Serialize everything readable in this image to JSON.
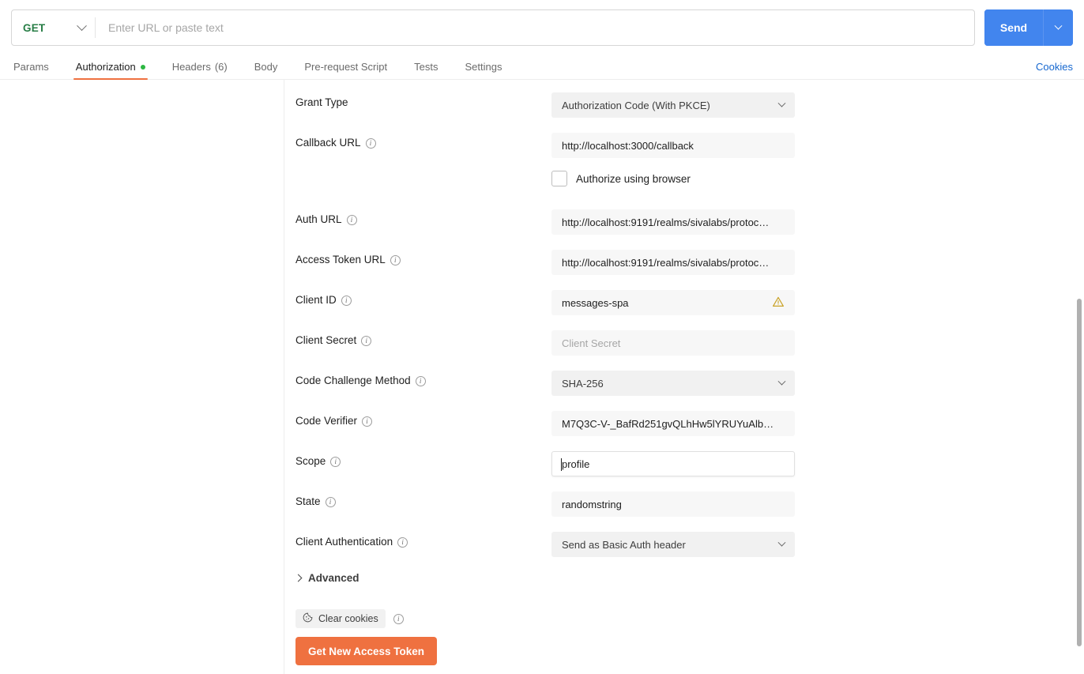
{
  "request_bar": {
    "method": "GET",
    "method_caret_icon": "chevron-down-icon",
    "url_value": "",
    "url_placeholder": "Enter URL or paste text",
    "send_label": "Send",
    "send_caret_icon": "chevron-down-icon",
    "send_color": "#4285ee"
  },
  "tabs": {
    "items": [
      {
        "label": "Params",
        "active": false,
        "dot": false,
        "count": ""
      },
      {
        "label": "Authorization",
        "active": true,
        "dot": true,
        "count": ""
      },
      {
        "label": "Headers",
        "active": false,
        "dot": false,
        "count": "(6)"
      },
      {
        "label": "Body",
        "active": false,
        "dot": false,
        "count": ""
      },
      {
        "label": "Pre-request Script",
        "active": false,
        "dot": false,
        "count": ""
      },
      {
        "label": "Tests",
        "active": false,
        "dot": false,
        "count": ""
      },
      {
        "label": "Settings",
        "active": false,
        "dot": false,
        "count": ""
      }
    ],
    "cookies_label": "Cookies",
    "active_underline_color": "#ef7140",
    "dot_color": "#2db742",
    "cookies_color": "#1667cf"
  },
  "form": {
    "grant_type": {
      "label": "Grant Type",
      "value": "Authorization Code (With PKCE)",
      "caret_icon": "chevron-down-icon"
    },
    "callback_url": {
      "label": "Callback URL",
      "info_icon": "info-icon",
      "value": "http://localhost:3000/callback"
    },
    "authorize_browser": {
      "label": "Authorize using browser",
      "checked": false
    },
    "auth_url": {
      "label": "Auth URL",
      "info_icon": "info-icon",
      "value": "http://localhost:9191/realms/sivalabs/protoc…"
    },
    "access_token_url": {
      "label": "Access Token URL",
      "info_icon": "info-icon",
      "value": "http://localhost:9191/realms/sivalabs/protoc…"
    },
    "client_id": {
      "label": "Client ID",
      "info_icon": "info-icon",
      "value": "messages-spa",
      "warning_icon": "warning-triangle-icon",
      "warning_color": "#c9a227"
    },
    "client_secret": {
      "label": "Client Secret",
      "info_icon": "info-icon",
      "value": "",
      "placeholder": "Client Secret"
    },
    "code_challenge_method": {
      "label": "Code Challenge Method",
      "info_icon": "info-icon",
      "value": "SHA-256",
      "caret_icon": "chevron-down-icon"
    },
    "code_verifier": {
      "label": "Code Verifier",
      "info_icon": "info-icon",
      "value": "M7Q3C-V-_BafRd251gvQLhHw5lYRUYuAlb…"
    },
    "scope": {
      "label": "Scope",
      "info_icon": "info-icon",
      "value": "profile",
      "focused": true
    },
    "state": {
      "label": "State",
      "info_icon": "info-icon",
      "value": "randomstring"
    },
    "client_authentication": {
      "label": "Client Authentication",
      "info_icon": "info-icon",
      "value": "Send as Basic Auth header",
      "caret_icon": "chevron-down-icon"
    },
    "advanced": {
      "label": "Advanced",
      "chevron_icon": "chevron-right-icon",
      "expanded": false
    },
    "clear_cookies": {
      "label": "Clear cookies",
      "cookie_icon": "cookie-icon",
      "info_icon": "info-icon"
    },
    "get_token_button": {
      "label": "Get New Access Token",
      "color": "#ef7140"
    }
  }
}
